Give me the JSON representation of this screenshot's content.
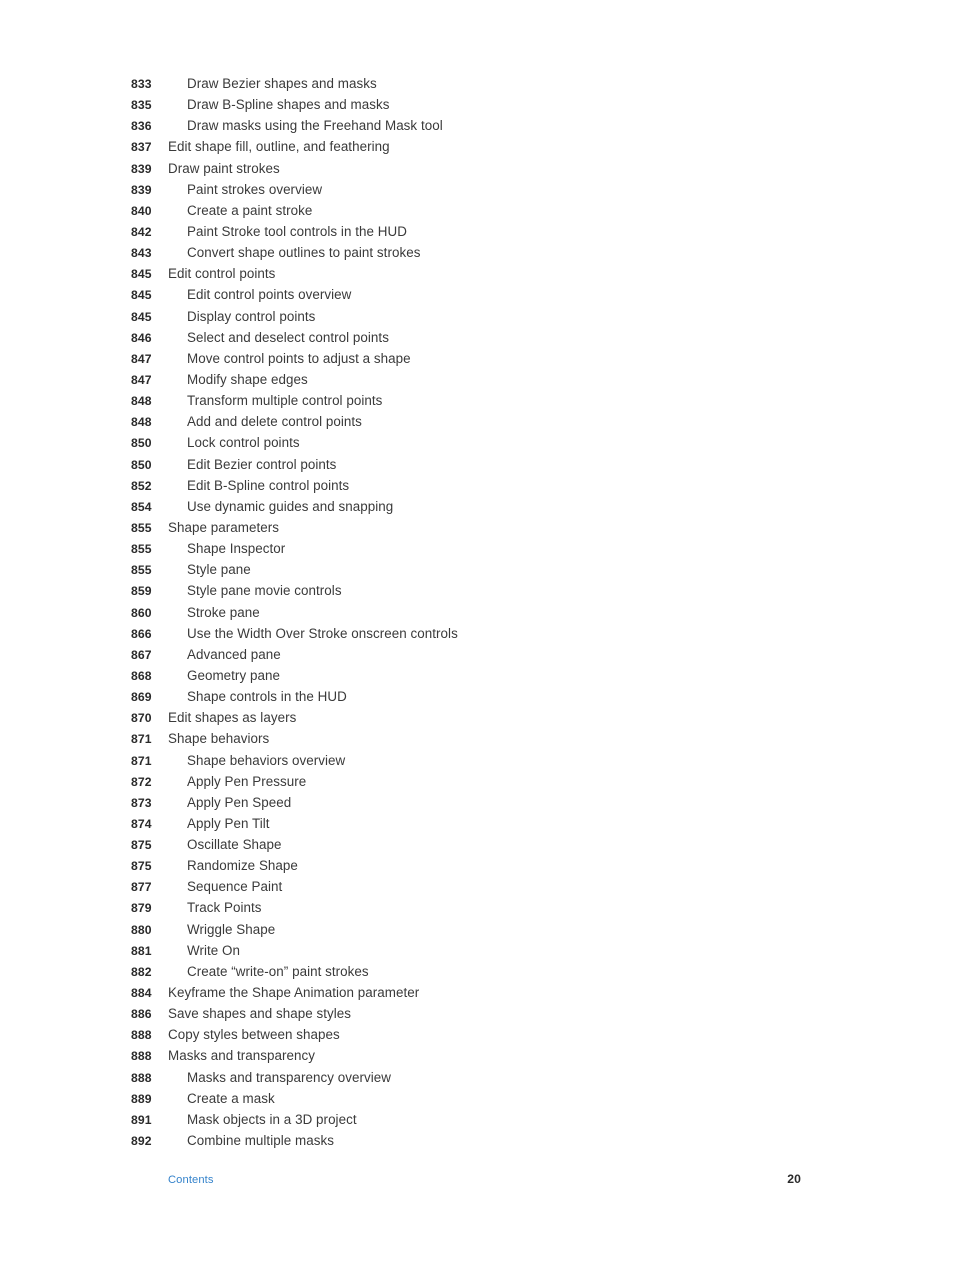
{
  "document": {
    "type": "table-of-contents",
    "page_number": "20",
    "footer_link_label": "Contents",
    "link_color": "#3583cb",
    "text_color": "#3a3a3a",
    "number_color": "#2b2b2b",
    "background_color": "#ffffff"
  },
  "toc": {
    "entries": [
      {
        "page": "833",
        "title": "Draw Bezier shapes and masks",
        "level": 2
      },
      {
        "page": "835",
        "title": "Draw B-Spline shapes and masks",
        "level": 2
      },
      {
        "page": "836",
        "title": "Draw masks using the Freehand Mask tool",
        "level": 2
      },
      {
        "page": "837",
        "title": "Edit shape fill, outline, and feathering",
        "level": 1
      },
      {
        "page": "839",
        "title": "Draw paint strokes",
        "level": 1
      },
      {
        "page": "839",
        "title": "Paint strokes overview",
        "level": 2
      },
      {
        "page": "840",
        "title": "Create a paint stroke",
        "level": 2
      },
      {
        "page": "842",
        "title": "Paint Stroke tool controls in the HUD",
        "level": 2
      },
      {
        "page": "843",
        "title": "Convert shape outlines to paint strokes",
        "level": 2
      },
      {
        "page": "845",
        "title": "Edit control points",
        "level": 1
      },
      {
        "page": "845",
        "title": "Edit control points overview",
        "level": 2
      },
      {
        "page": "845",
        "title": "Display control points",
        "level": 2
      },
      {
        "page": "846",
        "title": "Select and deselect control points",
        "level": 2
      },
      {
        "page": "847",
        "title": "Move control points to adjust a shape",
        "level": 2
      },
      {
        "page": "847",
        "title": "Modify shape edges",
        "level": 2
      },
      {
        "page": "848",
        "title": "Transform multiple control points",
        "level": 2
      },
      {
        "page": "848",
        "title": "Add and delete control points",
        "level": 2
      },
      {
        "page": "850",
        "title": "Lock control points",
        "level": 2
      },
      {
        "page": "850",
        "title": "Edit Bezier control points",
        "level": 2
      },
      {
        "page": "852",
        "title": "Edit B-Spline control points",
        "level": 2
      },
      {
        "page": "854",
        "title": "Use dynamic guides and snapping",
        "level": 2
      },
      {
        "page": "855",
        "title": "Shape parameters",
        "level": 1
      },
      {
        "page": "855",
        "title": "Shape Inspector",
        "level": 2
      },
      {
        "page": "855",
        "title": "Style pane",
        "level": 2
      },
      {
        "page": "859",
        "title": "Style pane movie controls",
        "level": 2
      },
      {
        "page": "860",
        "title": "Stroke pane",
        "level": 2
      },
      {
        "page": "866",
        "title": "Use the Width Over Stroke onscreen controls",
        "level": 2
      },
      {
        "page": "867",
        "title": "Advanced pane",
        "level": 2
      },
      {
        "page": "868",
        "title": "Geometry pane",
        "level": 2
      },
      {
        "page": "869",
        "title": "Shape controls in the HUD",
        "level": 2
      },
      {
        "page": "870",
        "title": "Edit shapes as layers",
        "level": 1
      },
      {
        "page": "871",
        "title": "Shape behaviors",
        "level": 1
      },
      {
        "page": "871",
        "title": "Shape behaviors overview",
        "level": 2
      },
      {
        "page": "872",
        "title": "Apply Pen Pressure",
        "level": 2
      },
      {
        "page": "873",
        "title": "Apply Pen Speed",
        "level": 2
      },
      {
        "page": "874",
        "title": "Apply Pen Tilt",
        "level": 2
      },
      {
        "page": "875",
        "title": "Oscillate Shape",
        "level": 2
      },
      {
        "page": "875",
        "title": "Randomize Shape",
        "level": 2
      },
      {
        "page": "877",
        "title": "Sequence Paint",
        "level": 2
      },
      {
        "page": "879",
        "title": "Track Points",
        "level": 2
      },
      {
        "page": "880",
        "title": "Wriggle Shape",
        "level": 2
      },
      {
        "page": "881",
        "title": "Write On",
        "level": 2
      },
      {
        "page": "882",
        "title": "Create “write-on” paint strokes",
        "level": 2
      },
      {
        "page": "884",
        "title": "Keyframe the Shape Animation parameter",
        "level": 1
      },
      {
        "page": "886",
        "title": "Save shapes and shape styles",
        "level": 1
      },
      {
        "page": "888",
        "title": "Copy styles between shapes",
        "level": 1
      },
      {
        "page": "888",
        "title": "Masks and transparency",
        "level": 1
      },
      {
        "page": "888",
        "title": "Masks and transparency overview",
        "level": 2
      },
      {
        "page": "889",
        "title": "Create a mask",
        "level": 2
      },
      {
        "page": "891",
        "title": "Mask objects in a 3D project",
        "level": 2
      },
      {
        "page": "892",
        "title": "Combine multiple masks",
        "level": 2
      }
    ]
  }
}
